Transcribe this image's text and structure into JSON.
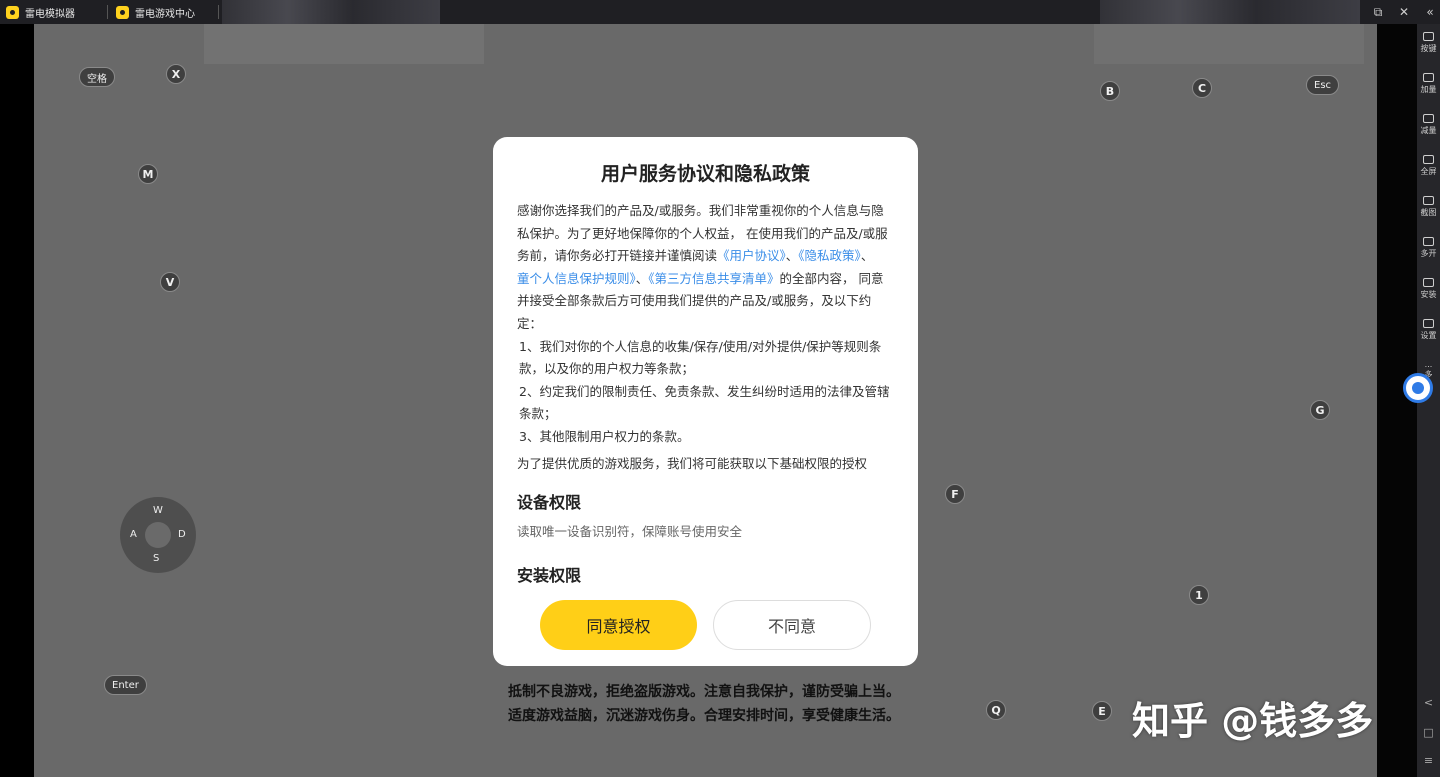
{
  "titlebar": {
    "tabs": [
      {
        "label": "雷电模拟器"
      },
      {
        "label": "雷电游戏中心"
      }
    ],
    "restore_icon": "⧉",
    "close_icon": "✕",
    "collapse_icon": "«"
  },
  "keys": {
    "space": "空格",
    "x": "X",
    "m": "M",
    "v": "V",
    "b": "B",
    "c": "C",
    "esc": "Esc",
    "g": "G",
    "f": "F",
    "one": "1",
    "q": "Q",
    "e": "E",
    "enter": "Enter",
    "joystick": {
      "w": "W",
      "a": "A",
      "s": "S",
      "d": "D"
    }
  },
  "game_notice": {
    "line1": "抵制不良游戏，拒绝盗版游戏。注意自我保护，谨防受骗上当。",
    "line2": "适度游戏益脑，沉迷游戏伤身。合理安排时间，享受健康生活。"
  },
  "modal": {
    "title": "用户服务协议和隐私政策",
    "intro_1": "感谢你选择我们的产品及/或服务。我们非常重视你的个人信息与隐私保护。为了更好地保障你的个人权益， 在使用我们的产品及/或服务前，请你务必打开链接并谨慎阅读",
    "link_user": "《用户协议》",
    "sep1": "、",
    "link_privacy": "《隐私政策》",
    "sep2": "、",
    "link_child": "童个人信息保护规则》",
    "sep3": "、",
    "link_third": "《第三方信息共享清单》",
    "intro_2": "的全部内容， 同意并接受全部条款后方可使用我们提供的产品及/或服务，及以下约定：",
    "item1": "1、我们对你的个人信息的收集/保存/使用/对外提供/保护等规则条款，以及你的用户权力等条款；",
    "item2": "2、约定我们的限制责任、免责条款、发生纠纷时适用的法律及管辖条款；",
    "item3": "3、其他限制用户权力的条款。",
    "permission_intro": "为了提供优质的游戏服务，我们将可能获取以下基础权限的授权",
    "perm_device_title": "设备权限",
    "perm_device_desc": "读取唯一设备识别符，保障账号使用安全",
    "perm_install_title": "安装权限",
    "agree_button": "同意授权",
    "disagree_button": "不同意"
  },
  "sidebar": {
    "items": [
      {
        "label": "按键"
      },
      {
        "label": "加量"
      },
      {
        "label": "减量"
      },
      {
        "label": "全屏"
      },
      {
        "label": "截图"
      },
      {
        "label": "多开"
      },
      {
        "label": "安装"
      },
      {
        "label": "设置"
      },
      {
        "label": "多"
      }
    ],
    "more_icon": "...",
    "back_icon": "<",
    "home_icon": "□",
    "menu_icon": "≡"
  },
  "watermark": "知乎 @钱多多"
}
